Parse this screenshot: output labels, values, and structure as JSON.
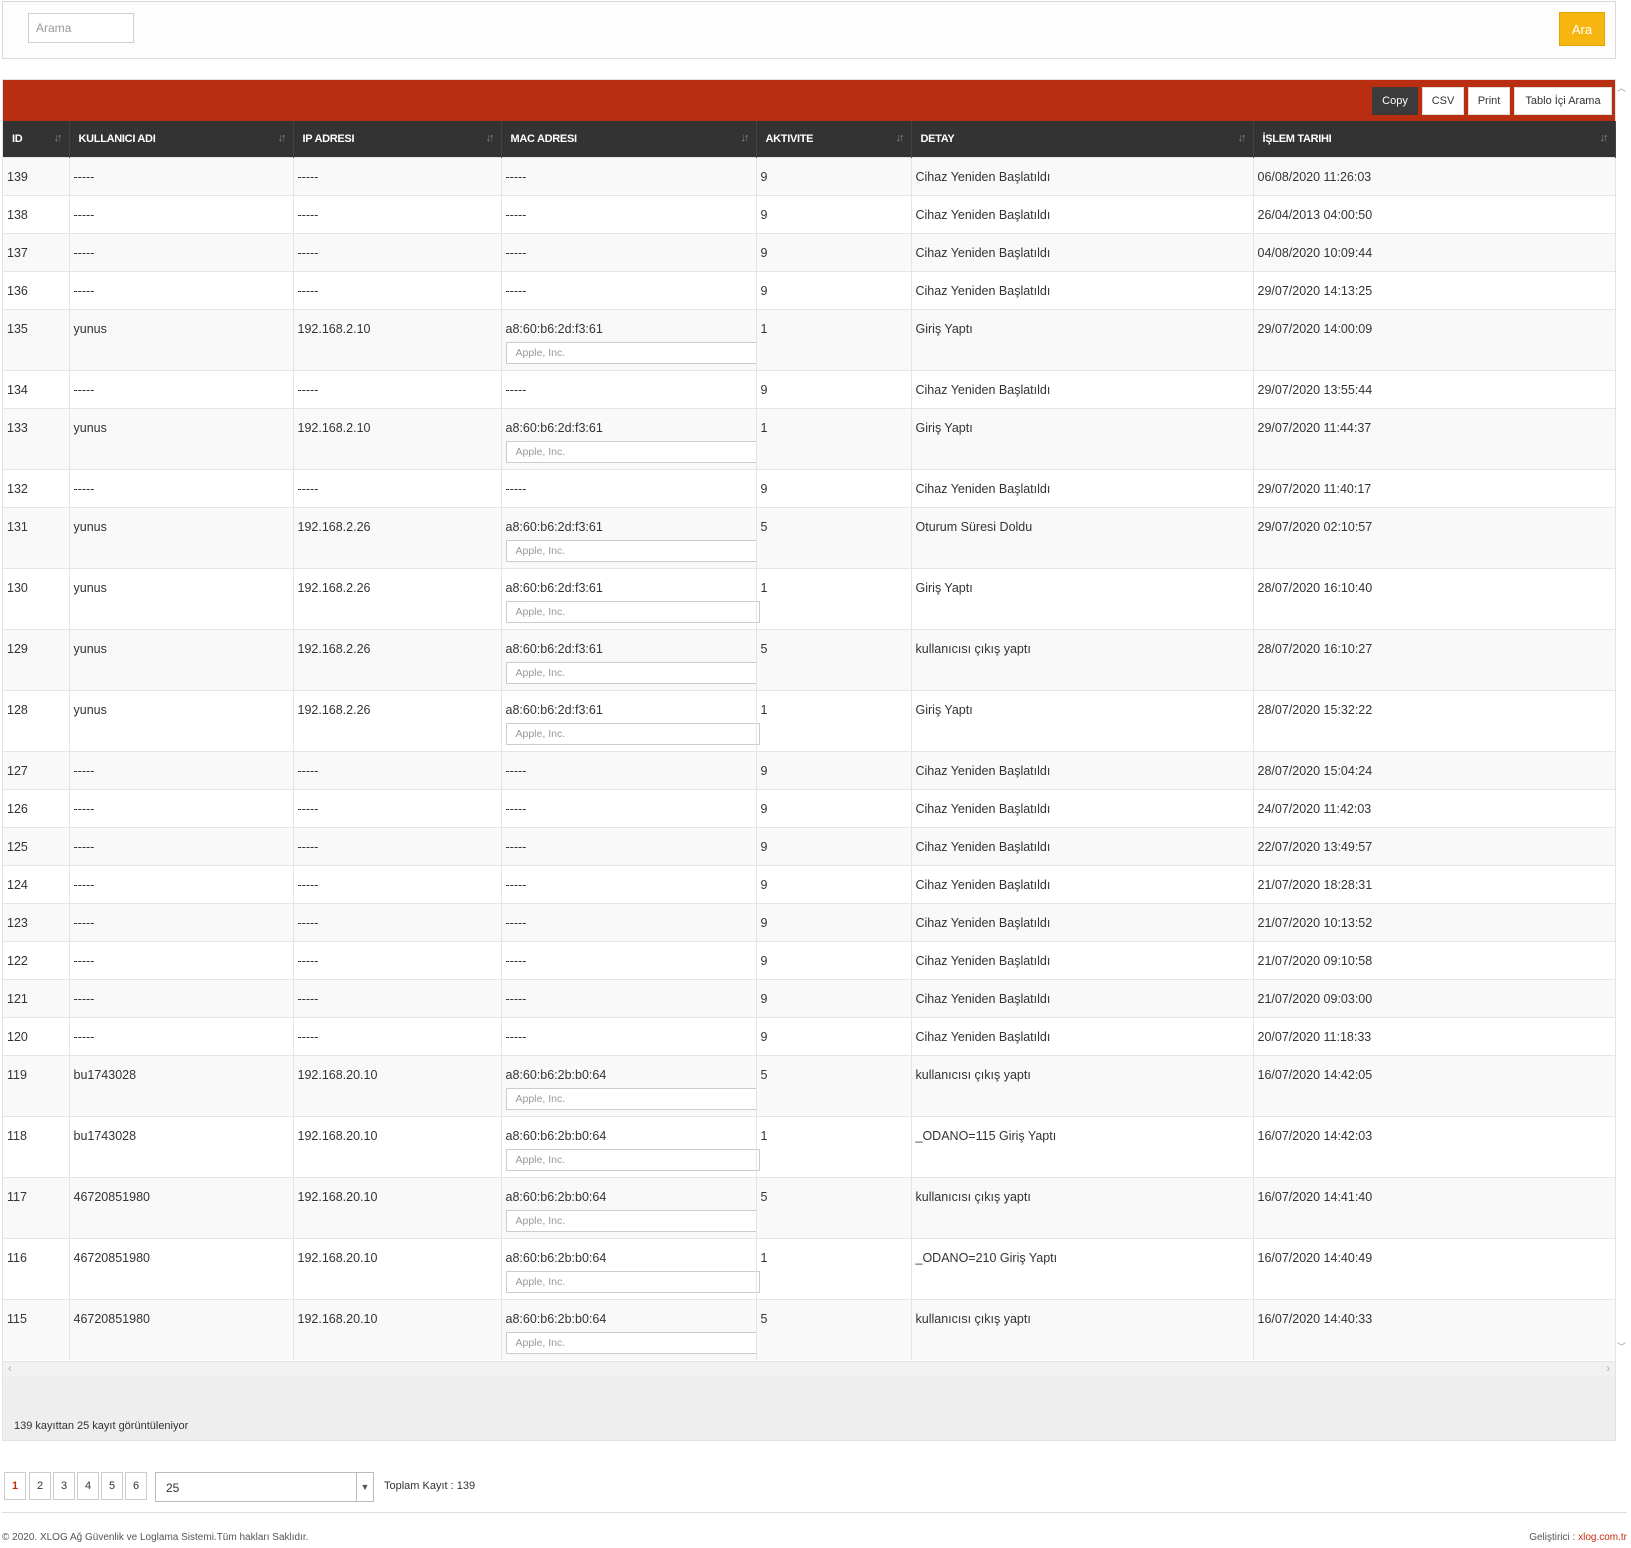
{
  "search": {
    "placeholder": "Arama",
    "button_label": "Ara"
  },
  "toolbar": {
    "copy": "Copy",
    "csv": "CSV",
    "print": "Print",
    "table_search": "Tablo İçi Arama"
  },
  "columns": [
    "ID",
    "KULLANICI ADI",
    "IP ADRESI",
    "MAC ADRESI",
    "AKTIVITE",
    "DETAY",
    "İŞLEM TARIHI"
  ],
  "rows": [
    {
      "id": "139",
      "user": "-----",
      "ip": "-----",
      "mac": "-----",
      "vendor": "",
      "activity": "9",
      "detail": "Cihaz Yeniden Başlatıldı",
      "date": "06/08/2020 11:26:03"
    },
    {
      "id": "138",
      "user": "-----",
      "ip": "-----",
      "mac": "-----",
      "vendor": "",
      "activity": "9",
      "detail": "Cihaz Yeniden Başlatıldı",
      "date": "26/04/2013 04:00:50"
    },
    {
      "id": "137",
      "user": "-----",
      "ip": "-----",
      "mac": "-----",
      "vendor": "",
      "activity": "9",
      "detail": "Cihaz Yeniden Başlatıldı",
      "date": "04/08/2020 10:09:44"
    },
    {
      "id": "136",
      "user": "-----",
      "ip": "-----",
      "mac": "-----",
      "vendor": "",
      "activity": "9",
      "detail": "Cihaz Yeniden Başlatıldı",
      "date": "29/07/2020 14:13:25"
    },
    {
      "id": "135",
      "user": "yunus",
      "ip": "192.168.2.10",
      "mac": "a8:60:b6:2d:f3:61",
      "vendor": "Apple, Inc.",
      "activity": "1",
      "detail": "Giriş Yaptı",
      "date": "29/07/2020 14:00:09"
    },
    {
      "id": "134",
      "user": "-----",
      "ip": "-----",
      "mac": "-----",
      "vendor": "",
      "activity": "9",
      "detail": "Cihaz Yeniden Başlatıldı",
      "date": "29/07/2020 13:55:44"
    },
    {
      "id": "133",
      "user": "yunus",
      "ip": "192.168.2.10",
      "mac": "a8:60:b6:2d:f3:61",
      "vendor": "Apple, Inc.",
      "activity": "1",
      "detail": "Giriş Yaptı",
      "date": "29/07/2020 11:44:37"
    },
    {
      "id": "132",
      "user": "-----",
      "ip": "-----",
      "mac": "-----",
      "vendor": "",
      "activity": "9",
      "detail": "Cihaz Yeniden Başlatıldı",
      "date": "29/07/2020 11:40:17"
    },
    {
      "id": "131",
      "user": "yunus",
      "ip": "192.168.2.26",
      "mac": "a8:60:b6:2d:f3:61",
      "vendor": "Apple, Inc.",
      "activity": "5",
      "detail": "Oturum Süresi Doldu",
      "date": "29/07/2020 02:10:57"
    },
    {
      "id": "130",
      "user": "yunus",
      "ip": "192.168.2.26",
      "mac": "a8:60:b6:2d:f3:61",
      "vendor": "Apple, Inc.",
      "activity": "1",
      "detail": "Giriş Yaptı",
      "date": "28/07/2020 16:10:40"
    },
    {
      "id": "129",
      "user": "yunus",
      "ip": "192.168.2.26",
      "mac": "a8:60:b6:2d:f3:61",
      "vendor": "Apple, Inc.",
      "activity": "5",
      "detail": "kullanıcısı çıkış yaptı",
      "date": "28/07/2020 16:10:27"
    },
    {
      "id": "128",
      "user": "yunus",
      "ip": "192.168.2.26",
      "mac": "a8:60:b6:2d:f3:61",
      "vendor": "Apple, Inc.",
      "activity": "1",
      "detail": "Giriş Yaptı",
      "date": "28/07/2020 15:32:22"
    },
    {
      "id": "127",
      "user": "-----",
      "ip": "-----",
      "mac": "-----",
      "vendor": "",
      "activity": "9",
      "detail": "Cihaz Yeniden Başlatıldı",
      "date": "28/07/2020 15:04:24"
    },
    {
      "id": "126",
      "user": "-----",
      "ip": "-----",
      "mac": "-----",
      "vendor": "",
      "activity": "9",
      "detail": "Cihaz Yeniden Başlatıldı",
      "date": "24/07/2020 11:42:03"
    },
    {
      "id": "125",
      "user": "-----",
      "ip": "-----",
      "mac": "-----",
      "vendor": "",
      "activity": "9",
      "detail": "Cihaz Yeniden Başlatıldı",
      "date": "22/07/2020 13:49:57"
    },
    {
      "id": "124",
      "user": "-----",
      "ip": "-----",
      "mac": "-----",
      "vendor": "",
      "activity": "9",
      "detail": "Cihaz Yeniden Başlatıldı",
      "date": "21/07/2020 18:28:31"
    },
    {
      "id": "123",
      "user": "-----",
      "ip": "-----",
      "mac": "-----",
      "vendor": "",
      "activity": "9",
      "detail": "Cihaz Yeniden Başlatıldı",
      "date": "21/07/2020 10:13:52"
    },
    {
      "id": "122",
      "user": "-----",
      "ip": "-----",
      "mac": "-----",
      "vendor": "",
      "activity": "9",
      "detail": "Cihaz Yeniden Başlatıldı",
      "date": "21/07/2020 09:10:58"
    },
    {
      "id": "121",
      "user": "-----",
      "ip": "-----",
      "mac": "-----",
      "vendor": "",
      "activity": "9",
      "detail": "Cihaz Yeniden Başlatıldı",
      "date": "21/07/2020 09:03:00"
    },
    {
      "id": "120",
      "user": "-----",
      "ip": "-----",
      "mac": "-----",
      "vendor": "",
      "activity": "9",
      "detail": "Cihaz Yeniden Başlatıldı",
      "date": "20/07/2020 11:18:33"
    },
    {
      "id": "119",
      "user": "bu1743028",
      "ip": "192.168.20.10",
      "mac": "a8:60:b6:2b:b0:64",
      "vendor": "Apple, Inc.",
      "activity": "5",
      "detail": "kullanıcısı çıkış yaptı",
      "date": "16/07/2020 14:42:05"
    },
    {
      "id": "118",
      "user": "bu1743028",
      "ip": "192.168.20.10",
      "mac": "a8:60:b6:2b:b0:64",
      "vendor": "Apple, Inc.",
      "activity": "1",
      "detail": "_ODANO=115 Giriş Yaptı",
      "date": "16/07/2020 14:42:03"
    },
    {
      "id": "117",
      "user": "46720851980",
      "ip": "192.168.20.10",
      "mac": "a8:60:b6:2b:b0:64",
      "vendor": "Apple, Inc.",
      "activity": "5",
      "detail": "kullanıcısı çıkış yaptı",
      "date": "16/07/2020 14:41:40"
    },
    {
      "id": "116",
      "user": "46720851980",
      "ip": "192.168.20.10",
      "mac": "a8:60:b6:2b:b0:64",
      "vendor": "Apple, Inc.",
      "activity": "1",
      "detail": "_ODANO=210 Giriş Yaptı",
      "date": "16/07/2020 14:40:49"
    },
    {
      "id": "115",
      "user": "46720851980",
      "ip": "192.168.20.10",
      "mac": "a8:60:b6:2b:b0:64",
      "vendor": "Apple, Inc.",
      "activity": "5",
      "detail": "kullanıcısı çıkış yaptı",
      "date": "16/07/2020 14:40:33"
    }
  ],
  "info_text": "139 kayıttan 25 kayıt görüntüleniyor",
  "pagination": {
    "pages": [
      "1",
      "2",
      "3",
      "4",
      "5",
      "6"
    ],
    "active": "1",
    "page_size": "25",
    "total_label": "Toplam Kayıt : 139"
  },
  "footer": {
    "copyright": "© 2020. XLOG Ağ Güvenlik ve Loglama Sistemi.Tüm hakları Saklıdır.",
    "developer_label": "Geliştirici :",
    "developer_link": "xlog.com.tr"
  },
  "colors": {
    "toolbar_bg": "#b92d10",
    "header_bg": "#333333",
    "search_button": "#f6b60f",
    "active_page": "#c82a0d"
  },
  "icons": {
    "sort": "sort-icon",
    "select_arrow": "chevron-down-icon"
  }
}
